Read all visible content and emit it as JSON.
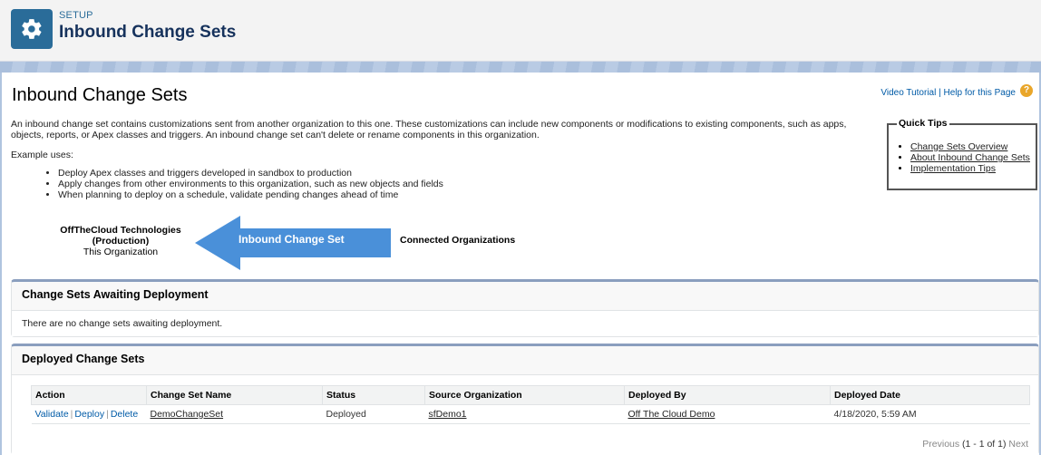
{
  "header": {
    "setup_label": "SETUP",
    "title": "Inbound Change Sets",
    "icon": "gear-icon"
  },
  "page": {
    "title": "Inbound Change Sets",
    "help": {
      "video_tutorial": "Video Tutorial",
      "separator": "|",
      "help_page": "Help for this Page",
      "help_icon": "?"
    },
    "intro": "An inbound change set contains customizations sent from another organization to this one. These customizations can include new components or modifications to existing components, such as apps, objects, reports, or Apex classes and triggers. An inbound change set can't delete or rename components in this organization.",
    "example_title": "Example uses:",
    "uses": [
      "Deploy Apex classes and triggers developed in sandbox to production",
      "Apply changes from other environments to this organization, such as new objects and fields",
      "When planning to deploy on a schedule, validate pending changes ahead of time"
    ]
  },
  "quick_tips": {
    "title": "Quick Tips",
    "links": [
      "Change Sets Overview",
      "About Inbound Change Sets",
      "Implementation Tips"
    ]
  },
  "diagram": {
    "org_name": "OffTheCloud Technologies",
    "org_type": "(Production)",
    "org_note": "This Organization",
    "arrow_label": "Inbound Change Set",
    "connected": "Connected Organizations",
    "arrow_color": "#4a90d9"
  },
  "awaiting": {
    "title": "Change Sets Awaiting Deployment",
    "empty": "There are no change sets awaiting deployment."
  },
  "deployed": {
    "title": "Deployed Change Sets",
    "columns": [
      "Action",
      "Change Set Name",
      "Status",
      "Source Organization",
      "Deployed By",
      "Deployed Date"
    ],
    "rows": [
      {
        "actions": [
          "Validate",
          "Deploy",
          "Delete"
        ],
        "name": "DemoChangeSet",
        "status": "Deployed",
        "source": "sfDemo1",
        "deployed_by": "Off The Cloud Demo",
        "date": "4/18/2020, 5:59 AM"
      }
    ],
    "pager": {
      "previous": "Previous",
      "range": "(1 - 1 of 1)",
      "next": "Next"
    }
  },
  "colors": {
    "brand": "#2a6c99",
    "link": "#015ba7",
    "panel_accent": "#8a9ebe"
  }
}
